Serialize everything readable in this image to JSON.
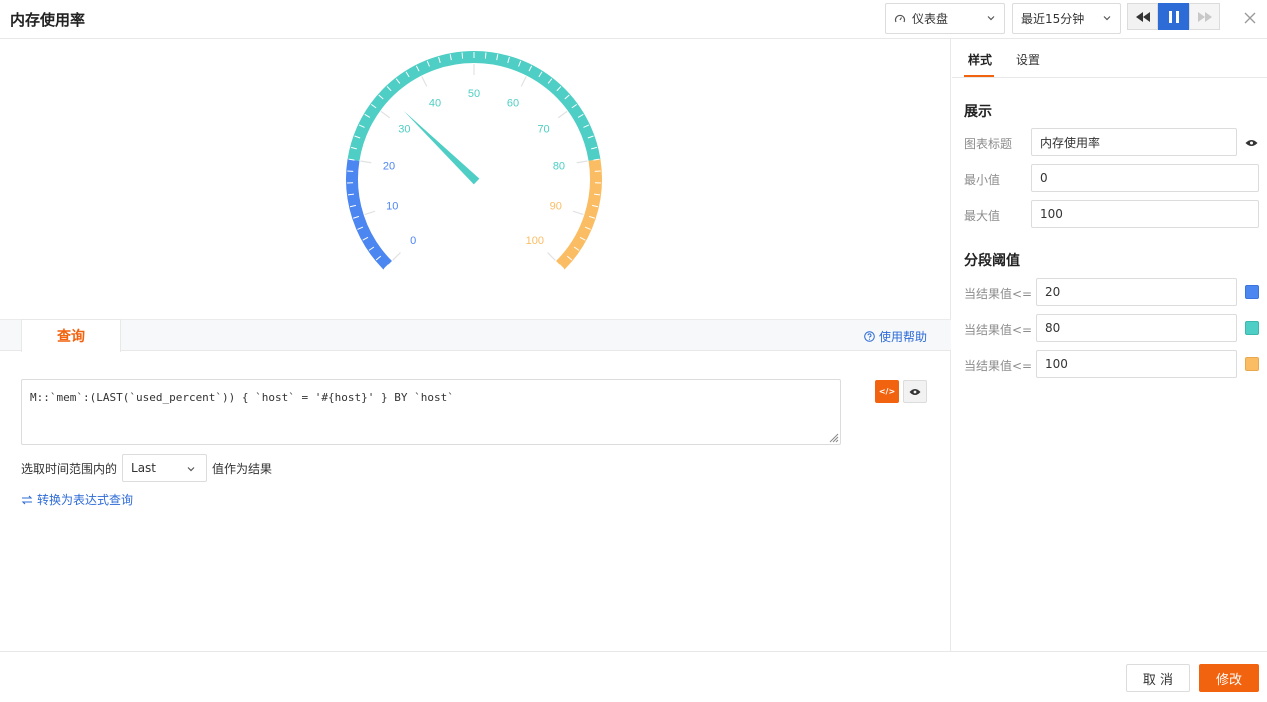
{
  "header": {
    "title": "内存使用率",
    "chart_type": {
      "label": "仪表盘",
      "icon": "gauge-icon"
    },
    "time_range": {
      "label": "最近15分钟"
    },
    "playback": {
      "rewind_icon": "rewind-icon",
      "pause_icon": "pause-icon",
      "forward_icon": "fast-forward-icon"
    },
    "close_icon": "close-icon"
  },
  "chart_data": {
    "type": "gauge",
    "min": 0,
    "max": 100,
    "value": 33,
    "tick_labels": [
      "0",
      "10",
      "20",
      "30",
      "40",
      "50",
      "60",
      "70",
      "80",
      "90",
      "100"
    ],
    "segments": [
      {
        "upto": 20,
        "color": "#4c86f0"
      },
      {
        "upto": 80,
        "color": "#4ecec4"
      },
      {
        "upto": 100,
        "color": "#fbbd63"
      }
    ]
  },
  "query": {
    "tab_label": "查询",
    "help_label": "使用帮助",
    "code": "M::`mem`:(LAST(`used_percent`)) { `host` = '#{host}' } BY `host`",
    "code_button_label": "</>",
    "range_prefix": "选取时间范围内的",
    "range_value": "Last",
    "range_suffix": "值作为结果",
    "convert_label": "转换为表达式查询"
  },
  "panel": {
    "tabs": [
      "样式",
      "设置"
    ],
    "display": {
      "title": "展示",
      "chart_title_label": "图表标题",
      "chart_title_value": "内存使用率",
      "min_label": "最小值",
      "min_value": "0",
      "max_label": "最大值",
      "max_value": "100"
    },
    "thresholds": {
      "title": "分段阈值",
      "items": [
        {
          "label": "当结果值<=",
          "value": "20",
          "color": "#4c86f0"
        },
        {
          "label": "当结果值<=",
          "value": "80",
          "color": "#4ecec4"
        },
        {
          "label": "当结果值<=",
          "value": "100",
          "color": "#fbbd63"
        }
      ]
    }
  },
  "footer": {
    "cancel_label": "取 消",
    "submit_label": "修改"
  }
}
